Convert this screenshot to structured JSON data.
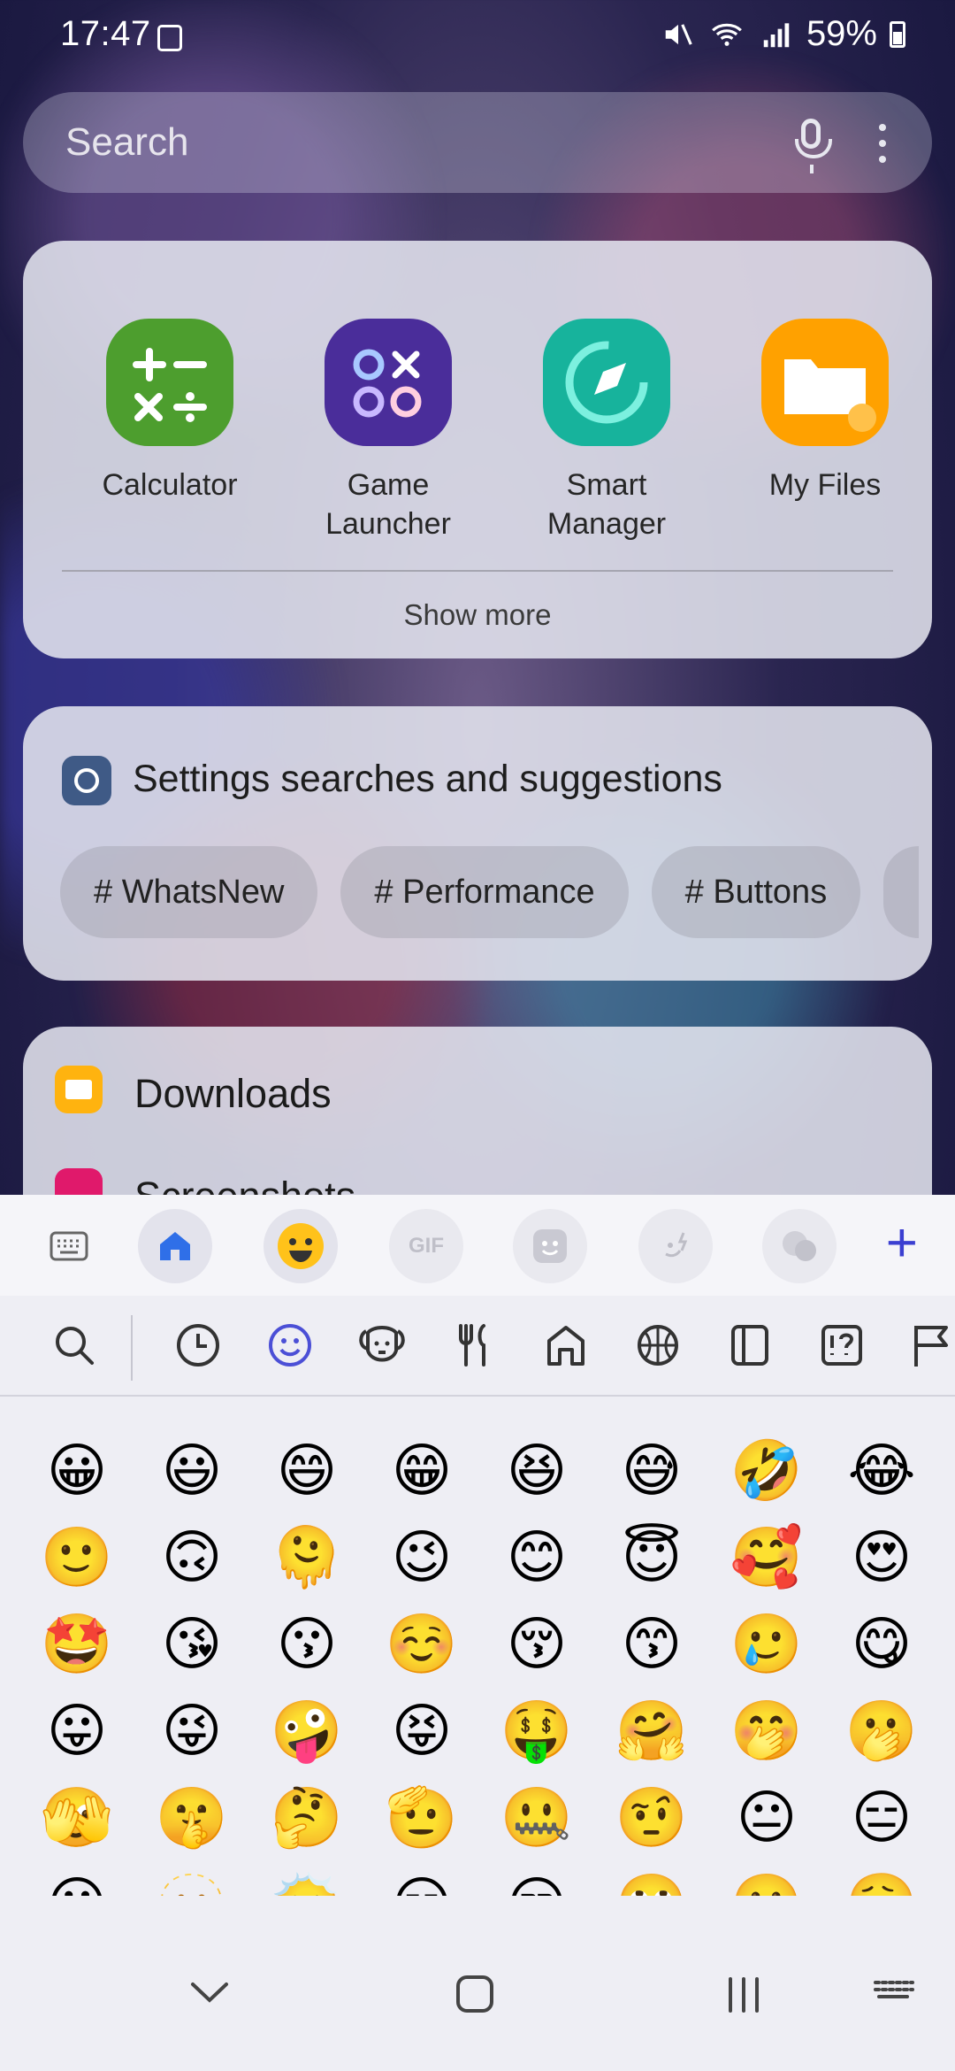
{
  "status": {
    "time": "17:47",
    "battery": "59%"
  },
  "search": {
    "placeholder": "Search"
  },
  "apps": [
    {
      "label": "Calculator",
      "icon": "calculator-icon",
      "color": "#4d9e2e"
    },
    {
      "label": "Game\nLauncher",
      "icon": "game-launcher-icon",
      "color": "#4a2d9a"
    },
    {
      "label": "Smart\nManager",
      "icon": "smart-manager-icon",
      "color": "#17b39c"
    },
    {
      "label": "My Files",
      "icon": "folder-icon",
      "color": "#ffa100"
    }
  ],
  "show_more": "Show more",
  "settings": {
    "title": "Settings searches and suggestions",
    "chips": [
      "# WhatsNew",
      "# Performance",
      "# Buttons"
    ]
  },
  "files": {
    "item1": "Downloads",
    "item2": "Screenshots"
  },
  "keyboard": {
    "toolbar_icons": [
      "keyboard-icon",
      "home-icon",
      "emoji-face-icon",
      "gif-icon",
      "sticker-icon",
      "bitmoji-icon",
      "avatar-icon",
      "plus-icon"
    ],
    "gif_label": "GIF",
    "plus_label": "+",
    "categories": [
      "search-icon",
      "recent-clock-icon",
      "smiley-icon",
      "animal-icon",
      "food-icon",
      "places-icon",
      "activities-icon",
      "objects-icon",
      "symbols-icon",
      "flags-icon"
    ],
    "emoji_rows": [
      [
        "😀",
        "😃",
        "😄",
        "😁",
        "😆",
        "😅",
        "🤣",
        "😂"
      ],
      [
        "🙂",
        "🙃",
        "🫠",
        "😉",
        "😊",
        "😇",
        "🥰",
        "😍"
      ],
      [
        "🤩",
        "😘",
        "😗",
        "☺️",
        "😚",
        "😙",
        "🥲",
        "😋"
      ],
      [
        "😛",
        "😜",
        "🤪",
        "😝",
        "🤑",
        "🤗",
        "🤭",
        "🫢"
      ],
      [
        "🫣",
        "🤫",
        "🤔",
        "🫡",
        "🤐",
        "🤨",
        "😐",
        "😑"
      ],
      [
        "😶",
        "🫥",
        "😶‍🌫️",
        "😏",
        "😒",
        "🙄",
        "😬",
        "😮‍💨"
      ]
    ]
  }
}
